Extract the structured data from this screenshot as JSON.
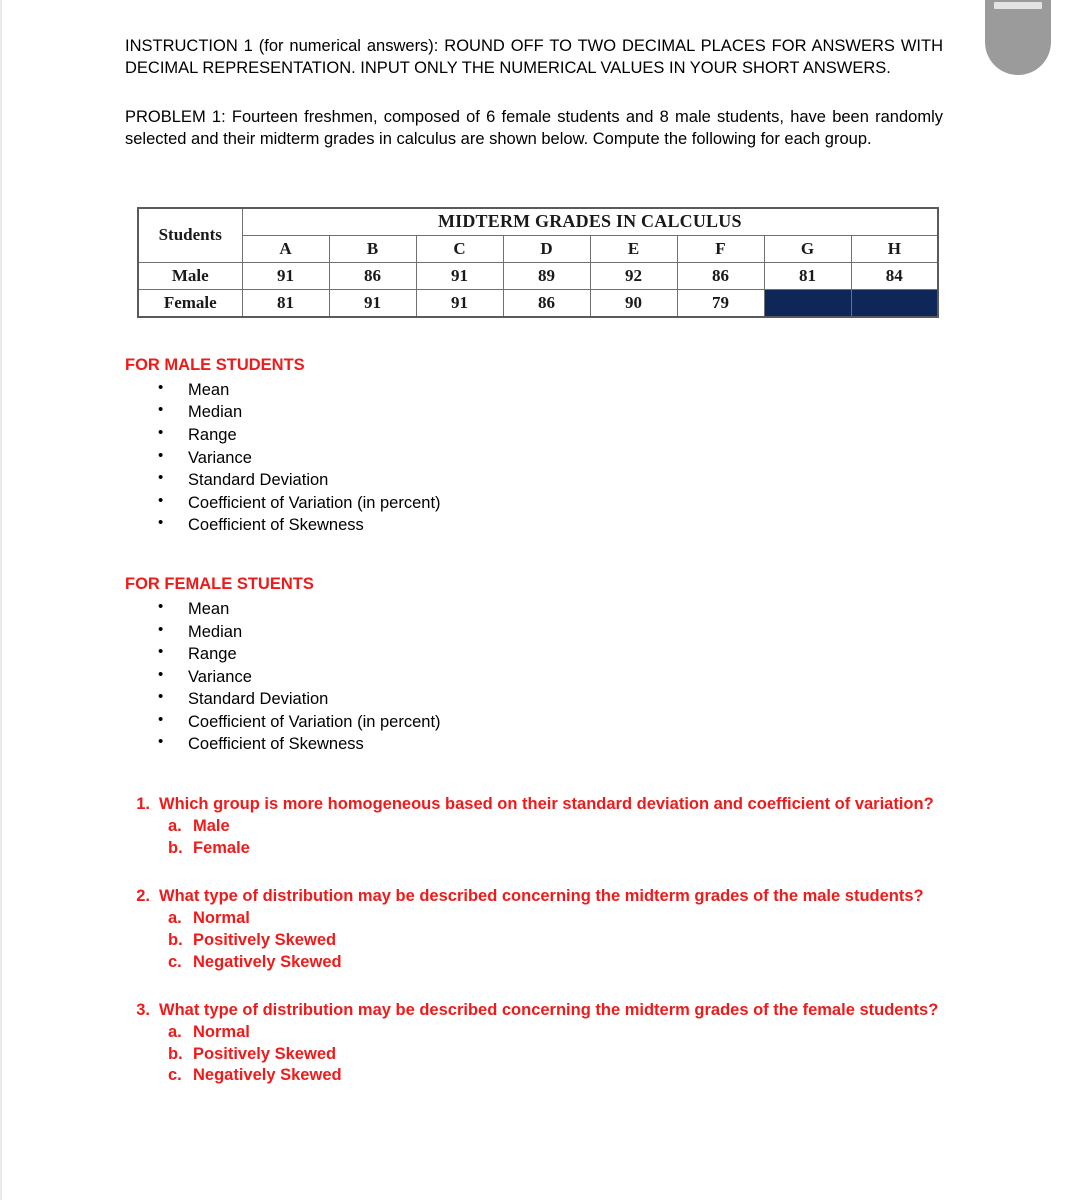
{
  "document": {
    "instruction": "INSTRUCTION 1 (for numerical answers): ROUND OFF TO TWO DECIMAL PLACES FOR ANSWERS WITH DECIMAL REPRESENTATION. INPUT ONLY THE NUMERICAL VALUES IN YOUR SHORT ANSWERS.",
    "problem": "PROBLEM 1: Fourteen freshmen, composed of 6 female students and 8 male students, have been randomly selected and their midterm grades in calculus are shown below. Compute the following for each group."
  },
  "table": {
    "corner_label": "Students",
    "title": "MIDTERM GRADES IN CALCULUS",
    "columns": [
      "A",
      "B",
      "C",
      "D",
      "E",
      "F",
      "G",
      "H"
    ],
    "rows": [
      {
        "label": "Male",
        "values": [
          "91",
          "86",
          "91",
          "89",
          "92",
          "86",
          "81",
          "84"
        ],
        "filled": [
          false,
          false,
          false,
          false,
          false,
          false,
          false,
          false
        ]
      },
      {
        "label": "Female",
        "values": [
          "81",
          "91",
          "91",
          "86",
          "90",
          "79",
          "",
          ""
        ],
        "filled": [
          false,
          false,
          false,
          false,
          false,
          false,
          true,
          true
        ]
      }
    ],
    "fill_color": "#0f2758"
  },
  "sections": [
    {
      "heading": "FOR MALE STUDENTS",
      "items": [
        "Mean",
        "Median",
        "Range",
        "Variance",
        "Standard Deviation",
        "Coefficient of Variation (in percent)",
        "Coefficient of Skewness"
      ]
    },
    {
      "heading": "FOR FEMALE STUENTS",
      "items": [
        "Mean",
        "Median",
        "Range",
        "Variance",
        "Standard Deviation",
        "Coefficient of Variation (in percent)",
        "Coefficient of Skewness"
      ]
    }
  ],
  "questions": [
    {
      "number": "1.",
      "text": "Which group is more homogeneous based on their standard deviation and coefficient of variation?",
      "options": [
        {
          "letter": "a.",
          "label": "Male"
        },
        {
          "letter": "b.",
          "label": "Female"
        }
      ]
    },
    {
      "number": "2.",
      "text": "What type of distribution may be described concerning the midterm grades of the male students?",
      "options": [
        {
          "letter": "a.",
          "label": "Normal"
        },
        {
          "letter": "b.",
          "label": "Positively Skewed"
        },
        {
          "letter": "c.",
          "label": "Negatively Skewed"
        }
      ]
    },
    {
      "number": "3.",
      "text": "What type of distribution may be described concerning the midterm grades of the female students?",
      "options": [
        {
          "letter": "a.",
          "label": "Normal"
        },
        {
          "letter": "b.",
          "label": "Positively Skewed"
        },
        {
          "letter": "c.",
          "label": "Negatively Skewed"
        }
      ]
    }
  ],
  "decor": {
    "badge_name": "shield-badge",
    "badge_color": "#9b9b9b",
    "accent_red": "#ef1b1b"
  }
}
